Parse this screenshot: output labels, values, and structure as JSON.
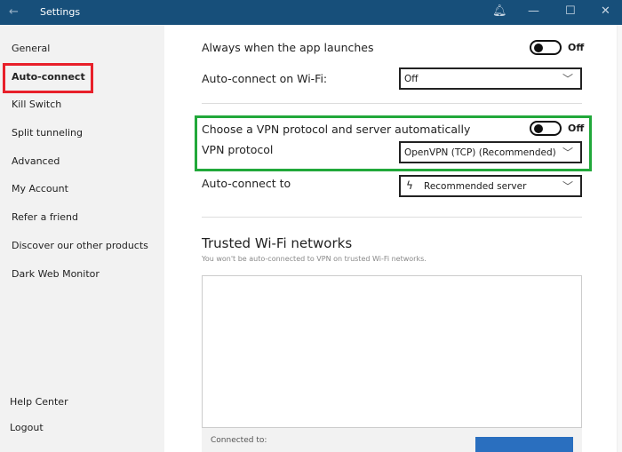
{
  "titlebar": {
    "title": "Settings"
  },
  "sidebar": {
    "items": [
      {
        "label": "General"
      },
      {
        "label": "Auto-connect"
      },
      {
        "label": "Kill Switch"
      },
      {
        "label": "Split tunneling"
      },
      {
        "label": "Advanced"
      },
      {
        "label": "My Account"
      },
      {
        "label": "Refer a friend"
      },
      {
        "label": "Discover our other products"
      },
      {
        "label": "Dark Web Monitor"
      }
    ],
    "bottom": [
      {
        "label": "Help Center"
      },
      {
        "label": "Logout"
      }
    ]
  },
  "main": {
    "launch": {
      "label": "Always when the app launches",
      "state": "Off"
    },
    "wifi": {
      "label": "Auto-connect on Wi-Fi:",
      "value": "Off"
    },
    "auto_protocol": {
      "label": "Choose a VPN protocol and server automatically",
      "state": "Off"
    },
    "protocol": {
      "label": "VPN protocol",
      "value": "OpenVPN (TCP) (Recommended)"
    },
    "connect_to": {
      "label": "Auto-connect to",
      "value": "Recommended server"
    },
    "trusted": {
      "title": "Trusted Wi-Fi networks",
      "subtitle": "You won't be auto-connected to VPN on trusted Wi-Fi networks.",
      "connected_label": "Connected to:"
    }
  },
  "colors": {
    "titlebar": "#174f7a",
    "highlight_red": "#e8202a",
    "highlight_green": "#21a83a",
    "button": "#2a6fbf"
  }
}
